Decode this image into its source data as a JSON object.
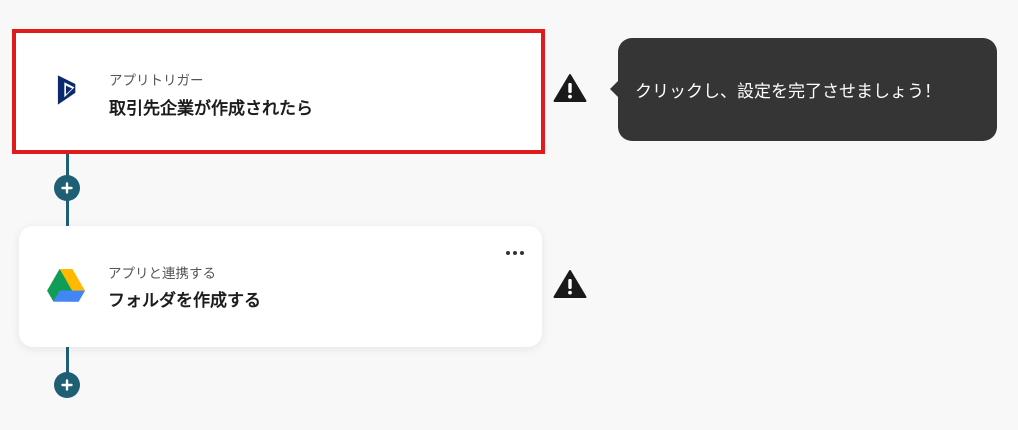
{
  "flow": {
    "steps": [
      {
        "app_name": "Microsoft Dynamics 365",
        "icon": "dynamics-365-icon",
        "subtitle": "アプリトリガー",
        "title": "取引先企業が作成されたら",
        "status": "warning",
        "selected": true
      },
      {
        "app_name": "Google Drive",
        "icon": "google-drive-icon",
        "subtitle": "アプリと連携する",
        "title": "フォルダを作成する",
        "status": "warning",
        "selected": false
      }
    ],
    "tooltip": "クリックし、設定を完了させましょう！"
  },
  "colors": {
    "background": "#f8f8f8",
    "connector": "#1f5f73",
    "highlight_border": "#e01b1b",
    "tooltip_bg": "#353535",
    "warning": "#1a1a1a"
  }
}
